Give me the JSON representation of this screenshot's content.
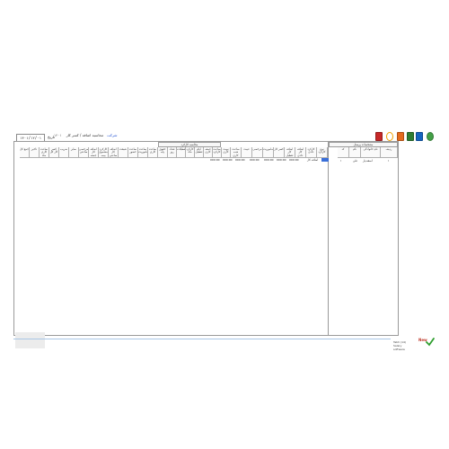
{
  "toolbar": {
    "icons": [
      "report-icon",
      "clock-icon",
      "table-icon",
      "color-icon",
      "chart-icon",
      "refresh-icon"
    ],
    "colors": [
      "#c62828",
      "#f0a000",
      "#e46a1d",
      "#2e7d32",
      "#1565c0",
      "#43a047"
    ]
  },
  "header": {
    "date_value": "۱۴۰۱/۱۲/۰۱",
    "date_label": "تاریخ",
    "title": "محاسبه اضافه / کسر کار",
    "link": "شرکت",
    "code": "۱۴۰۱"
  },
  "right_table": {
    "group": "مشخصات پرسنل",
    "columns": [
      "ردیف",
      "نام خانوادگی",
      "نام",
      "کد"
    ],
    "row": [
      "۱",
      "اسفندیار",
      "علی",
      "۱"
    ]
  },
  "left_table": {
    "group": "محاسبه کارکرد",
    "columns": [
      "نوع کارکرد",
      "کارکرد عادی",
      "اضافه کار عادی",
      "اضافه کار تعطیل",
      "کسر کار",
      "ماموریت",
      "مرخصی",
      "غیبت",
      "ساعت شب کاری",
      "نوبت کاری",
      "ساعت کارکرد",
      "جمعه کاری",
      "ایام تعطیل",
      "کارکرد ماه",
      "تعطیلات",
      "تعداد روز",
      "حقوق پایه",
      "ساعت کاری",
      "ساعت ماموریت",
      "ساعت حضور",
      "شیفت",
      "اضافه کار ساعتی",
      "کارکرد مشمول بیمه",
      "اضافه کار جمعه",
      "مرخصی ساعتی",
      "سایر",
      "ضریب",
      "کسر کار کل",
      "ساعت کاری ماه",
      "تاخیر",
      "جمع کل"
    ],
    "row": [
      "اضافه کار",
      "000:00",
      "000:00",
      "000:00",
      "000:00",
      "000:00",
      "000:00",
      "000:00"
    ]
  },
  "status": {
    "logo_line1": "Tabh (14)",
    "logo_line2": "Salary software",
    "mark": "New"
  }
}
